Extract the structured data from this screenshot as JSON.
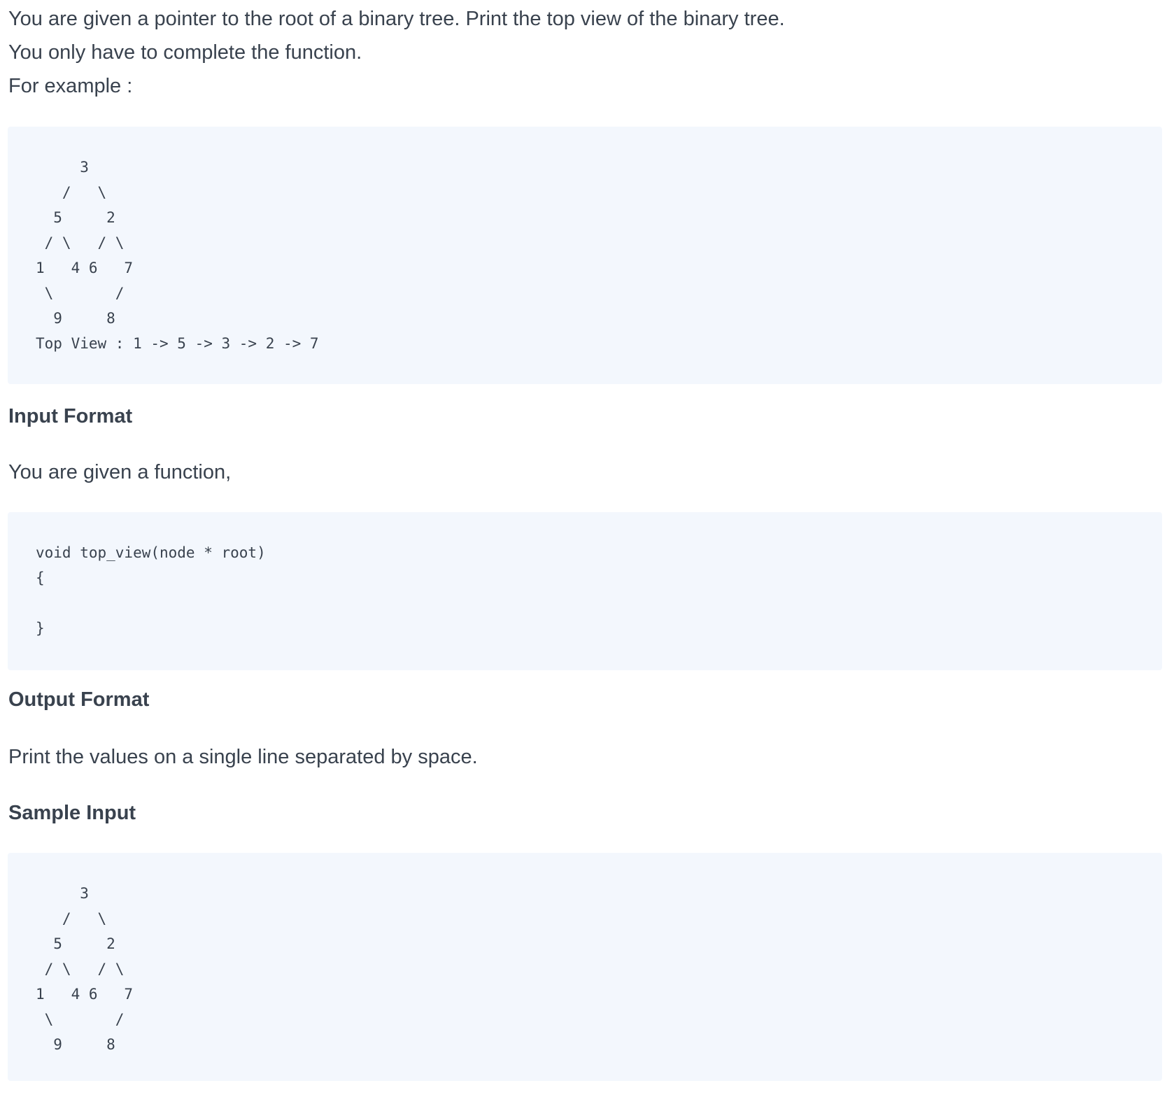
{
  "intro": {
    "lines": [
      "You are given a pointer to the root of a binary tree. Print the top view of the binary tree.",
      "You only have to complete the function.",
      "For example :"
    ]
  },
  "example_code": "     3\n   /   \\\n  5     2\n / \\   / \\\n1   4 6   7\n \\       /\n  9     8\nTop View : 1 -> 5 -> 3 -> 2 -> 7",
  "input_format": {
    "heading": "Input Format",
    "text": "You are given a function,",
    "code": "void top_view(node * root)\n{\n\n}"
  },
  "output_format": {
    "heading": "Output Format",
    "text": "Print the values on a single line separated by space."
  },
  "sample_input": {
    "heading": "Sample Input",
    "code": "     3\n   /   \\\n  5     2\n / \\   / \\\n1   4 6   7\n \\       /\n  9     8"
  },
  "colors": {
    "text": "#39424e",
    "code_background": "#f3f7fd"
  }
}
